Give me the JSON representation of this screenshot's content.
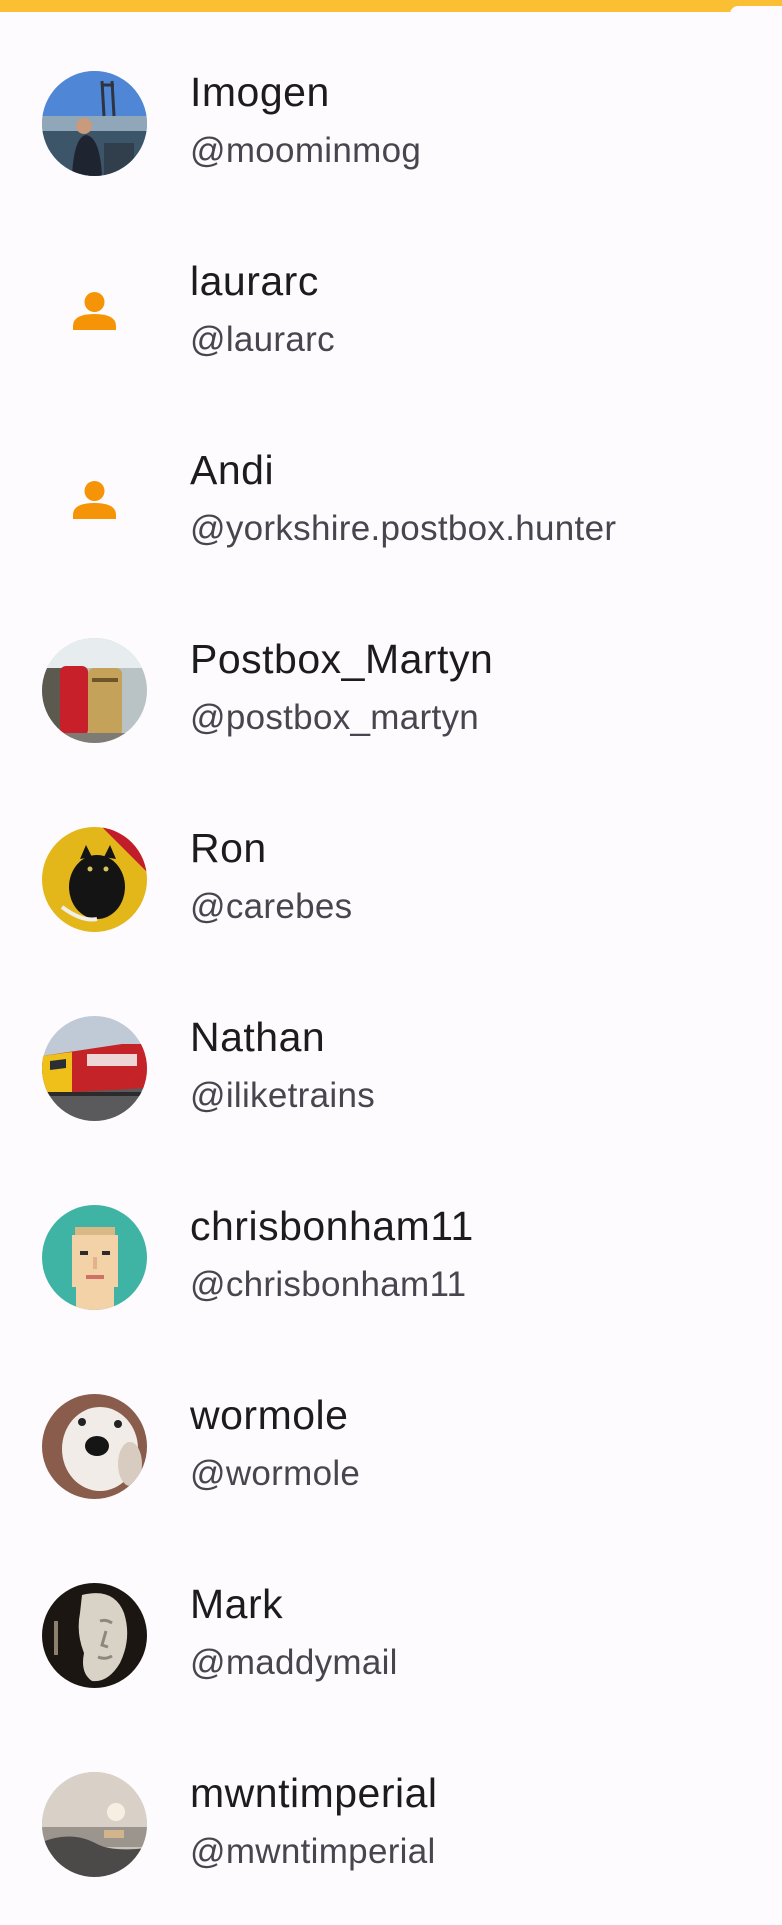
{
  "colors": {
    "accent": "#fbbf33",
    "placeholder_icon": "#f59406",
    "name_text": "#1c1b1f",
    "handle_text": "#49454f"
  },
  "users": [
    {
      "name": "Imogen",
      "handle": "@moominmog",
      "avatar": "photo-icon"
    },
    {
      "name": "laurarc",
      "handle": "@laurarc",
      "avatar": "person-icon"
    },
    {
      "name": "Andi",
      "handle": "@yorkshire.postbox.hunter",
      "avatar": "person-icon"
    },
    {
      "name": "Postbox_Martyn",
      "handle": "@postbox_martyn",
      "avatar": "photo-icon"
    },
    {
      "name": "Ron",
      "handle": "@carebes",
      "avatar": "photo-icon"
    },
    {
      "name": "Nathan",
      "handle": "@iliketrains",
      "avatar": "photo-icon"
    },
    {
      "name": "chrisbonham11",
      "handle": "@chrisbonham11",
      "avatar": "photo-icon"
    },
    {
      "name": "wormole",
      "handle": "@wormole",
      "avatar": "photo-icon"
    },
    {
      "name": "Mark",
      "handle": "@maddymail",
      "avatar": "photo-icon"
    },
    {
      "name": "mwntimperial",
      "handle": "@mwntimperial",
      "avatar": "photo-icon"
    }
  ]
}
